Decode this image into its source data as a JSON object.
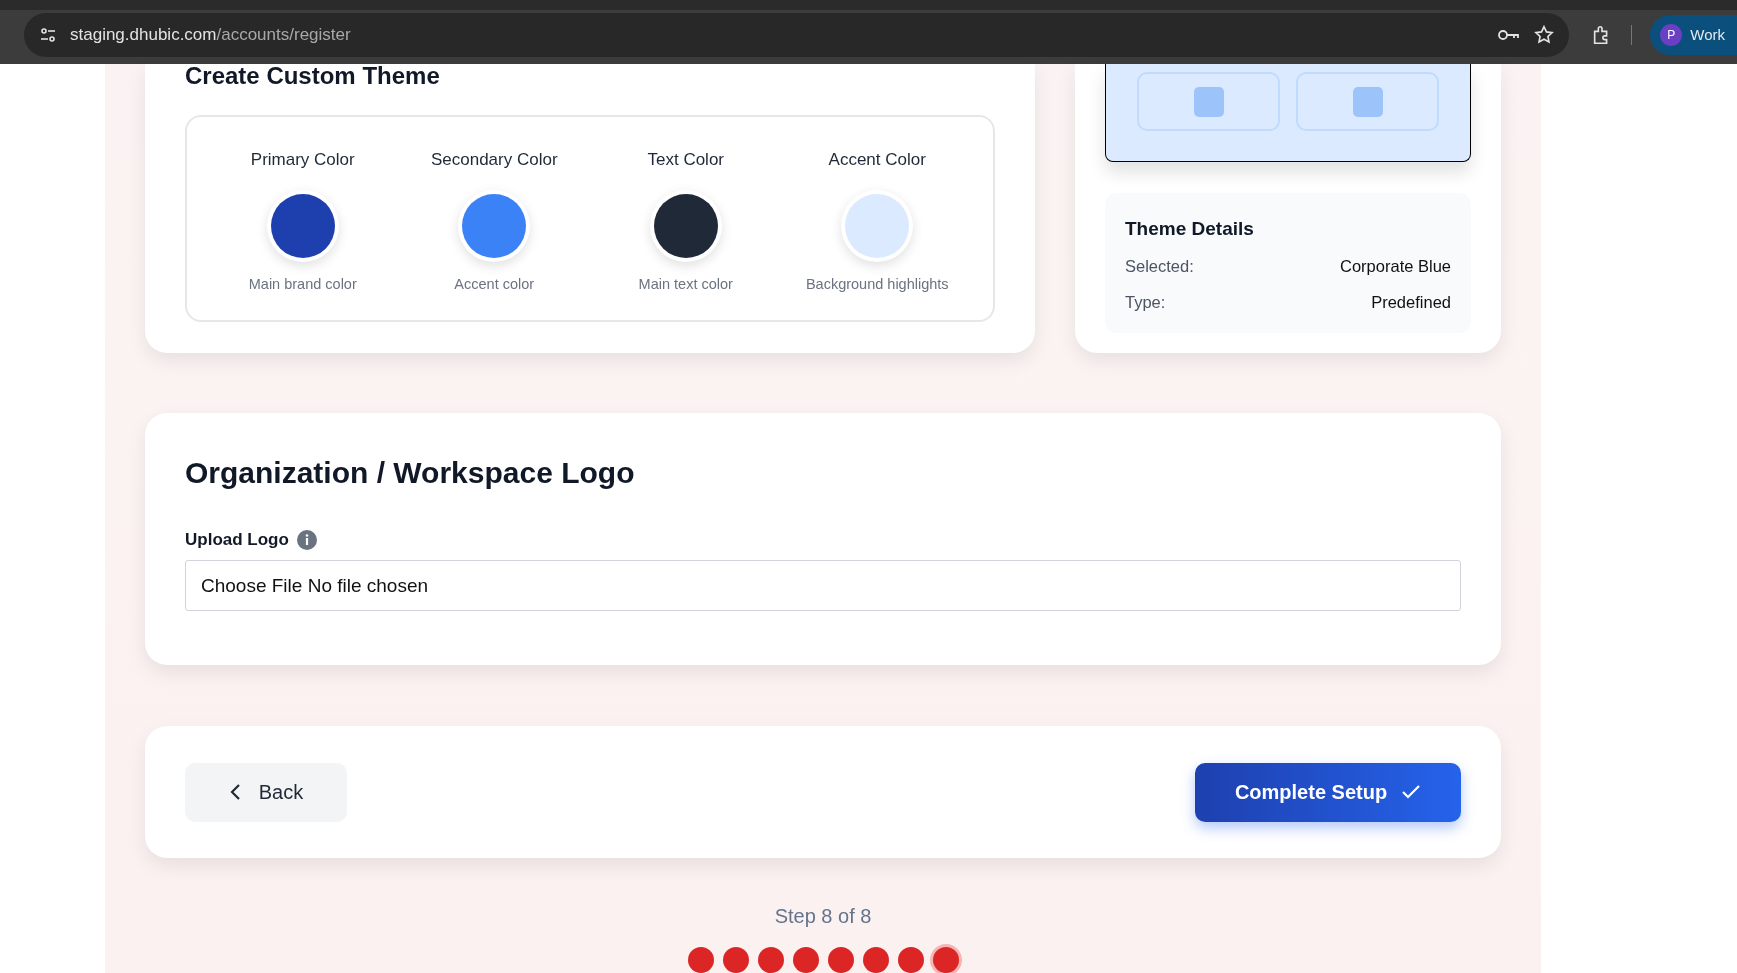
{
  "browser": {
    "url_host": "staging.dhubic.com",
    "url_path": "/accounts/register",
    "profile_initial": "P",
    "profile_name": "Work"
  },
  "custom_theme": {
    "title": "Create Custom Theme",
    "colors": [
      {
        "label": "Primary Color",
        "color": "#1e40af",
        "caption": "Main brand color"
      },
      {
        "label": "Secondary Color",
        "color": "#3b82f6",
        "caption": "Accent color"
      },
      {
        "label": "Text Color",
        "color": "#1f2937",
        "caption": "Main text color"
      },
      {
        "label": "Accent Color",
        "color": "#dbeafe",
        "caption": "Background highlights"
      }
    ]
  },
  "theme_details": {
    "title": "Theme Details",
    "rows": [
      {
        "label": "Selected:",
        "value": "Corporate Blue"
      },
      {
        "label": "Type:",
        "value": "Predefined"
      }
    ]
  },
  "logo_section": {
    "title": "Organization / Workspace Logo",
    "label": "Upload Logo",
    "file_button": "Choose File",
    "file_status": "No file chosen"
  },
  "actions": {
    "back": "Back",
    "complete": "Complete Setup"
  },
  "progress": {
    "text": "Step 8 of 8",
    "steps": [
      {
        "current": false
      },
      {
        "current": false
      },
      {
        "current": false
      },
      {
        "current": false
      },
      {
        "current": false
      },
      {
        "current": false
      },
      {
        "current": false
      },
      {
        "current": true
      }
    ]
  }
}
